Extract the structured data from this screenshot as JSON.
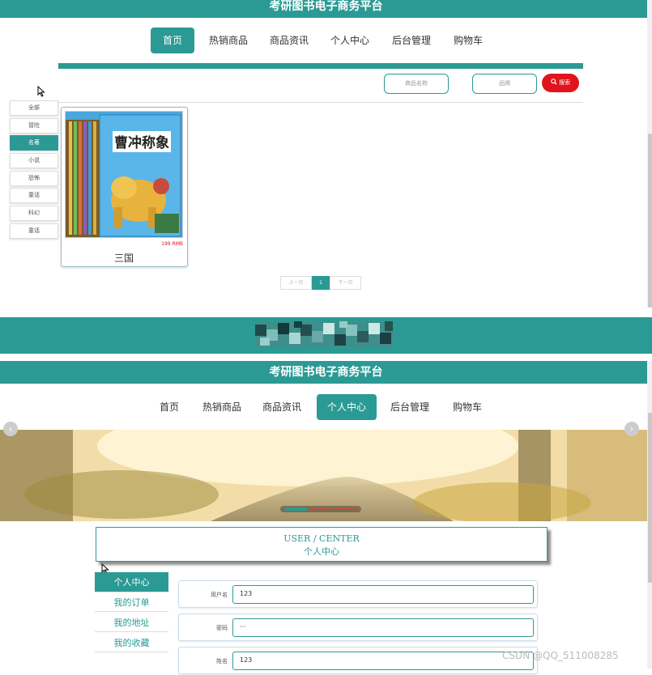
{
  "app_title": "考研图书电子商务平台",
  "top_nav": [
    {
      "label": "首页",
      "active": true
    },
    {
      "label": "热销商品",
      "active": false
    },
    {
      "label": "商品资讯",
      "active": false
    },
    {
      "label": "个人中心",
      "active": false
    },
    {
      "label": "后台管理",
      "active": false
    },
    {
      "label": "购物车",
      "active": false
    }
  ],
  "search": {
    "name_placeholder": "商品名称",
    "brand_placeholder": "品牌",
    "button_label": "搜索",
    "button_color": "#e0141c"
  },
  "categories": [
    {
      "label": "全部",
      "active": false
    },
    {
      "label": "冒险",
      "active": false
    },
    {
      "label": "名著",
      "active": true
    },
    {
      "label": "小说",
      "active": false
    },
    {
      "label": "恐怖",
      "active": false
    },
    {
      "label": "童话",
      "active": false
    },
    {
      "label": "科幻",
      "active": false
    },
    {
      "label": "童话",
      "active": false
    }
  ],
  "product": {
    "cover_title": "曹冲称象",
    "price": "199 RMB",
    "name": "三国"
  },
  "pagination": {
    "prev_label": "上一页",
    "current": "1",
    "next_label": "下一页"
  },
  "bottom_nav": [
    {
      "label": "首页",
      "active": false
    },
    {
      "label": "热销商品",
      "active": false
    },
    {
      "label": "商品资讯",
      "active": false
    },
    {
      "label": "个人中心",
      "active": true
    },
    {
      "label": "后台管理",
      "active": false
    },
    {
      "label": "购物车",
      "active": false
    }
  ],
  "user_center": {
    "title_en": "USER / CENTER",
    "title_cn": "个人中心"
  },
  "side_menu": [
    {
      "label": "个人中心",
      "active": true
    },
    {
      "label": "我的订单",
      "active": false
    },
    {
      "label": "我的地址",
      "active": false
    },
    {
      "label": "我的收藏",
      "active": false
    }
  ],
  "form": [
    {
      "label": "用户名",
      "value": "123"
    },
    {
      "label": "密码",
      "value": "···"
    },
    {
      "label": "姓名",
      "value": "123"
    }
  ],
  "watermark": "CSDN @QQ_511008285",
  "accent_color": "#2b9a94"
}
